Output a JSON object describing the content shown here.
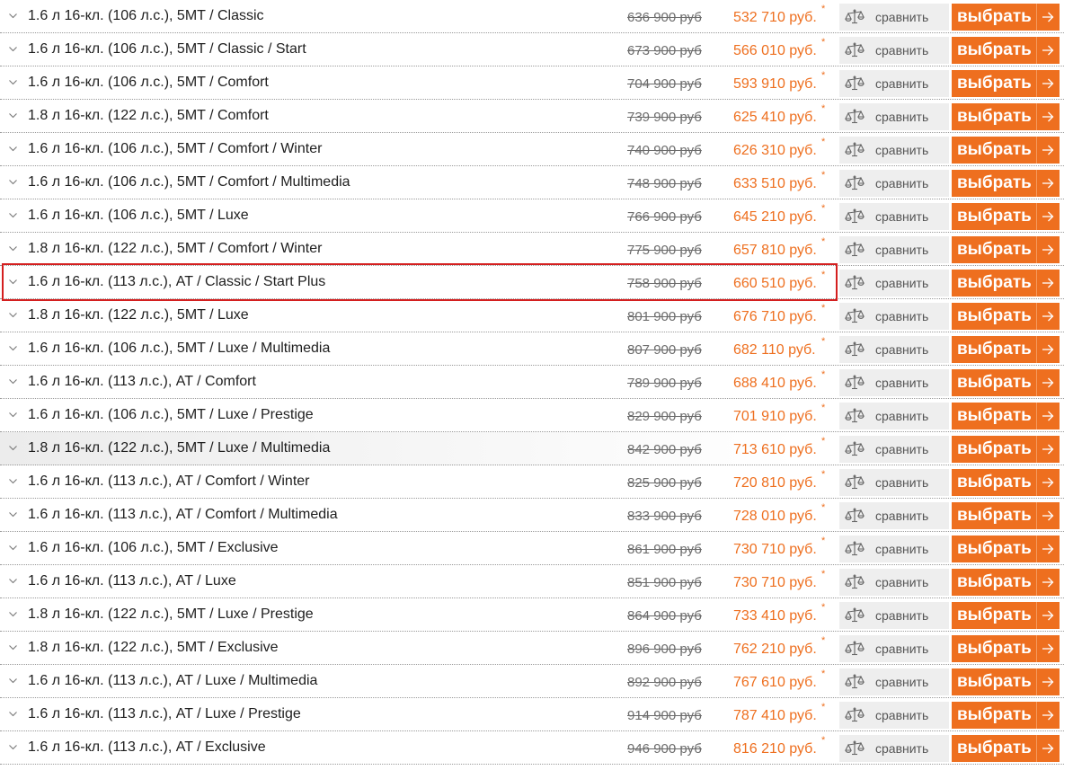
{
  "compare_label": "сравнить",
  "select_label": "выбрать",
  "price_marker": "*",
  "icons": {
    "expand": "chevron-down-icon",
    "compare": "scales-icon",
    "select": "arrow-right-icon"
  },
  "colors": {
    "accent": "#ee6f1f",
    "compare_bg": "#eeeeee",
    "selection_frame": "#d41f1f"
  },
  "selected_index": 8,
  "hovered_index": 13,
  "rows": [
    {
      "title": "1.6 л 16-кл. (106 л.с.), 5MT / Classic",
      "old_price": "636 900 руб",
      "new_price": "532 710 руб."
    },
    {
      "title": "1.6 л 16-кл. (106 л.с.), 5MT / Classic / Start",
      "old_price": "673 900 руб",
      "new_price": "566 010 руб."
    },
    {
      "title": "1.6 л 16-кл. (106 л.с.), 5MT / Comfort",
      "old_price": "704 900 руб",
      "new_price": "593 910 руб."
    },
    {
      "title": "1.8 л 16-кл. (122 л.с.), 5MT / Comfort",
      "old_price": "739 900 руб",
      "new_price": "625 410 руб."
    },
    {
      "title": "1.6 л 16-кл. (106 л.с.), 5MT / Comfort / Winter",
      "old_price": "740 900 руб",
      "new_price": "626 310 руб."
    },
    {
      "title": "1.6 л 16-кл. (106 л.с.), 5MT / Comfort / Multimedia",
      "old_price": "748 900 руб",
      "new_price": "633 510 руб."
    },
    {
      "title": "1.6 л 16-кл. (106 л.с.), 5MT / Luxe",
      "old_price": "766 900 руб",
      "new_price": "645 210 руб."
    },
    {
      "title": "1.8 л 16-кл. (122 л.с.), 5MT / Comfort / Winter",
      "old_price": "775 900 руб",
      "new_price": "657 810 руб."
    },
    {
      "title": "1.6 л 16-кл. (113 л.с.), AT / Classic / Start Plus",
      "old_price": "758 900 руб",
      "new_price": "660 510 руб."
    },
    {
      "title": "1.8 л 16-кл. (122 л.с.), 5MT / Luxe",
      "old_price": "801 900 руб",
      "new_price": "676 710 руб."
    },
    {
      "title": "1.6 л 16-кл. (106 л.с.), 5MT / Luxe / Multimedia",
      "old_price": "807 900 руб",
      "new_price": "682 110 руб."
    },
    {
      "title": "1.6 л 16-кл. (113 л.с.), AT / Comfort",
      "old_price": "789 900 руб",
      "new_price": "688 410 руб."
    },
    {
      "title": "1.6 л 16-кл. (106 л.с.), 5MT / Luxe / Prestige",
      "old_price": "829 900 руб",
      "new_price": "701 910 руб."
    },
    {
      "title": "1.8 л 16-кл. (122 л.с.), 5MT / Luxe / Multimedia",
      "old_price": "842 900 руб",
      "new_price": "713 610 руб."
    },
    {
      "title": "1.6 л 16-кл. (113 л.с.), AT / Comfort / Winter",
      "old_price": "825 900 руб",
      "new_price": "720 810 руб."
    },
    {
      "title": "1.6 л 16-кл. (113 л.с.), AT / Comfort / Multimedia",
      "old_price": "833 900 руб",
      "new_price": "728 010 руб."
    },
    {
      "title": "1.6 л 16-кл. (106 л.с.), 5MT / Exclusive",
      "old_price": "861 900 руб",
      "new_price": "730 710 руб."
    },
    {
      "title": "1.6 л 16-кл. (113 л.с.), AT / Luxe",
      "old_price": "851 900 руб",
      "new_price": "730 710 руб."
    },
    {
      "title": "1.8 л 16-кл. (122 л.с.), 5MT / Luxe / Prestige",
      "old_price": "864 900 руб",
      "new_price": "733 410 руб."
    },
    {
      "title": "1.8 л 16-кл. (122 л.с.), 5MT / Exclusive",
      "old_price": "896 900 руб",
      "new_price": "762 210 руб."
    },
    {
      "title": "1.6 л 16-кл. (113 л.с.), AT / Luxe / Multimedia",
      "old_price": "892 900 руб",
      "new_price": "767 610 руб."
    },
    {
      "title": "1.6 л 16-кл. (113 л.с.), AT / Luxe / Prestige",
      "old_price": "914 900 руб",
      "new_price": "787 410 руб."
    },
    {
      "title": "1.6 л 16-кл. (113 л.с.), AT / Exclusive",
      "old_price": "946 900 руб",
      "new_price": "816 210 руб."
    }
  ]
}
